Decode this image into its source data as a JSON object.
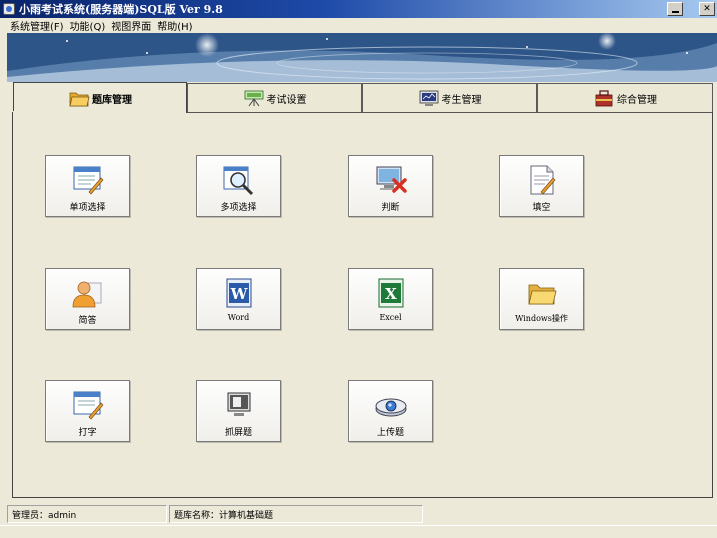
{
  "window": {
    "title": "小雨考试系统(服务器端)SQL版 Ver 9.8"
  },
  "menu": {
    "items": [
      {
        "label": "系统管理(F)"
      },
      {
        "label": "功能(Q)"
      },
      {
        "label": "视图界面"
      },
      {
        "label": "帮助(H)"
      }
    ]
  },
  "tabs": [
    {
      "label": "题库管理",
      "icon": "folder-icon",
      "active": true
    },
    {
      "label": "考试设置",
      "icon": "projector-icon",
      "active": false
    },
    {
      "label": "考生管理",
      "icon": "monitor-icon",
      "active": false
    },
    {
      "label": "综合管理",
      "icon": "toolbox-icon",
      "active": false
    }
  ],
  "tiles": [
    {
      "label": "单项选择",
      "icon": "single-choice-icon"
    },
    {
      "label": "多项选择",
      "icon": "magnifier-icon"
    },
    {
      "label": "判断",
      "icon": "judge-icon"
    },
    {
      "label": "填空",
      "icon": "fill-blank-icon"
    },
    {
      "label": "简答",
      "icon": "user-icon"
    },
    {
      "label": "Word",
      "icon": "word-icon"
    },
    {
      "label": "Excel",
      "icon": "excel-icon"
    },
    {
      "label": "Windows操作",
      "icon": "folder-icon"
    },
    {
      "label": "打字",
      "icon": "typing-icon"
    },
    {
      "label": "抓屏题",
      "icon": "screenshot-icon"
    },
    {
      "label": "上传题",
      "icon": "upload-icon"
    }
  ],
  "status": {
    "admin": "管理员：admin",
    "bank": "题库名称：计算机基础题"
  },
  "colors": {
    "titlebar_start": "#0a246a",
    "titlebar_end": "#a6caf0",
    "window_bg": "#ece9d8",
    "banner": "#274d7d"
  }
}
